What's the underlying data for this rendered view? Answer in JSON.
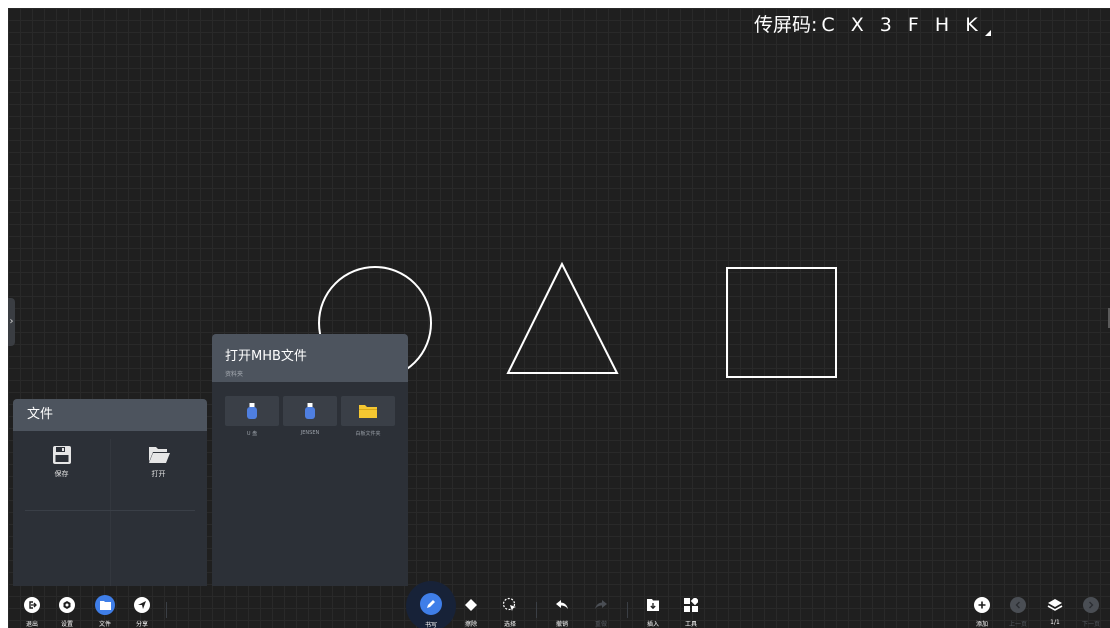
{
  "screen_code": {
    "label": "传屏码:",
    "value": "C X 3 F H K"
  },
  "file_panel": {
    "title": "文件",
    "items": [
      {
        "label": "保存",
        "icon": "save-icon"
      },
      {
        "label": "打开",
        "icon": "folder-open-icon"
      }
    ]
  },
  "mhb_panel": {
    "title": "打开MHB文件",
    "subtitle": "资料夹",
    "sources": [
      {
        "label": "U 盘",
        "icon": "usb-drive-icon"
      },
      {
        "label": "JENSEN",
        "icon": "usb-drive-icon"
      },
      {
        "label": "白板文件夹",
        "icon": "folder-icon"
      }
    ]
  },
  "toolbar": {
    "exit": "退出",
    "settings": "设置",
    "file": "文件",
    "share": "分享",
    "write": "书写",
    "erase": "擦除",
    "select": "选择",
    "undo": "撤销",
    "redo": "重做",
    "insert": "插入",
    "tools": "工具",
    "add": "添加",
    "prev": "上一页",
    "page": "1/1",
    "next": "下一页"
  },
  "colors": {
    "board": "#1f1f1f",
    "grid": "#292929",
    "panel": "#2c3037",
    "panel_header": "#4d545e",
    "accent": "#3f7ee8",
    "folder": "#f5c731"
  }
}
